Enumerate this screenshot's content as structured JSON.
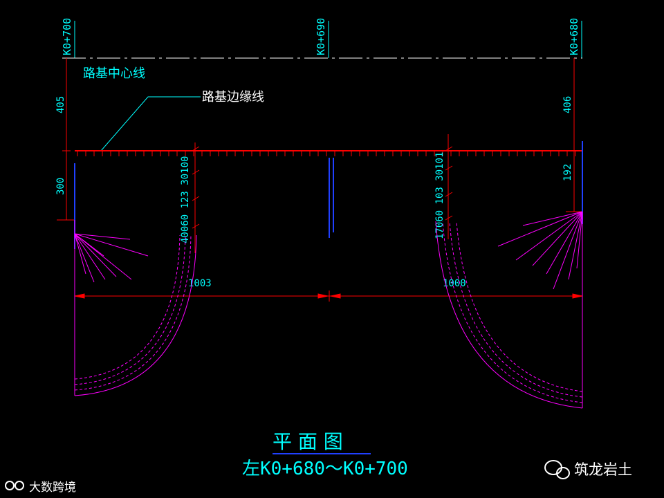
{
  "stations": {
    "left": "K0+700",
    "middle": "K0+690",
    "right": "K0+680"
  },
  "labels": {
    "centerline": "路基中心线",
    "edgeline": "路基边缘线"
  },
  "dimensions": {
    "left_vertical_top": "405",
    "left_vertical_bottom": "300",
    "right_vertical_top": "406",
    "right_vertical_bottom": "192",
    "left_horizontal": "1003",
    "right_horizontal": "1000",
    "left_stack": "40060 123 30100",
    "right_stack": "17060 103 30101"
  },
  "title": {
    "main": "平  面  图",
    "sub": "左K0+680～K0+700"
  },
  "watermarks": {
    "left": "大数跨境",
    "right": "筑龙岩土"
  },
  "colors": {
    "background": "#000000",
    "cyan": "#00ffff",
    "red": "#ff0000",
    "magenta": "#ff00ff",
    "blue": "#2040ff",
    "white": "#ffffff"
  }
}
